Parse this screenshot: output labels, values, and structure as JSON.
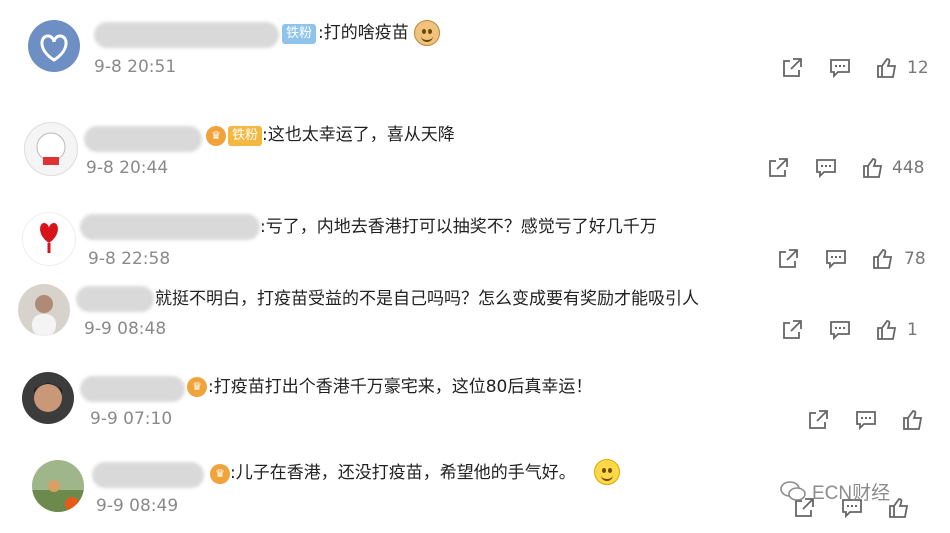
{
  "comments": [
    {
      "text": ":打的啥疫苗",
      "time": "9-8 20:51",
      "badge": "铁粉",
      "likes": "12"
    },
    {
      "text": ":这也太幸运了，喜从天降",
      "time": "9-8 20:44",
      "badge": "铁粉",
      "likes": "448"
    },
    {
      "text": ":亏了，内地去香港打可以抽奖不？感觉亏了好几千万",
      "time": "9-8 22:58",
      "likes": "78"
    },
    {
      "text": "就挺不明白，打疫苗受益的不是自己吗吗？怎么变成要有奖励才能吸引人",
      "time": "9-9 08:48",
      "likes": "1"
    },
    {
      "text": ":打疫苗打出个香港千万豪宅来，这位80后真幸运！",
      "time": "9-9 07:10",
      "likes": ""
    },
    {
      "text": ":儿子在香港，还没打疫苗，希望他的手气好。",
      "time": "9-9 08:49",
      "likes": ""
    }
  ],
  "watermark": "ECN财经",
  "icons": [
    "share-icon",
    "comment-icon",
    "like-icon"
  ]
}
